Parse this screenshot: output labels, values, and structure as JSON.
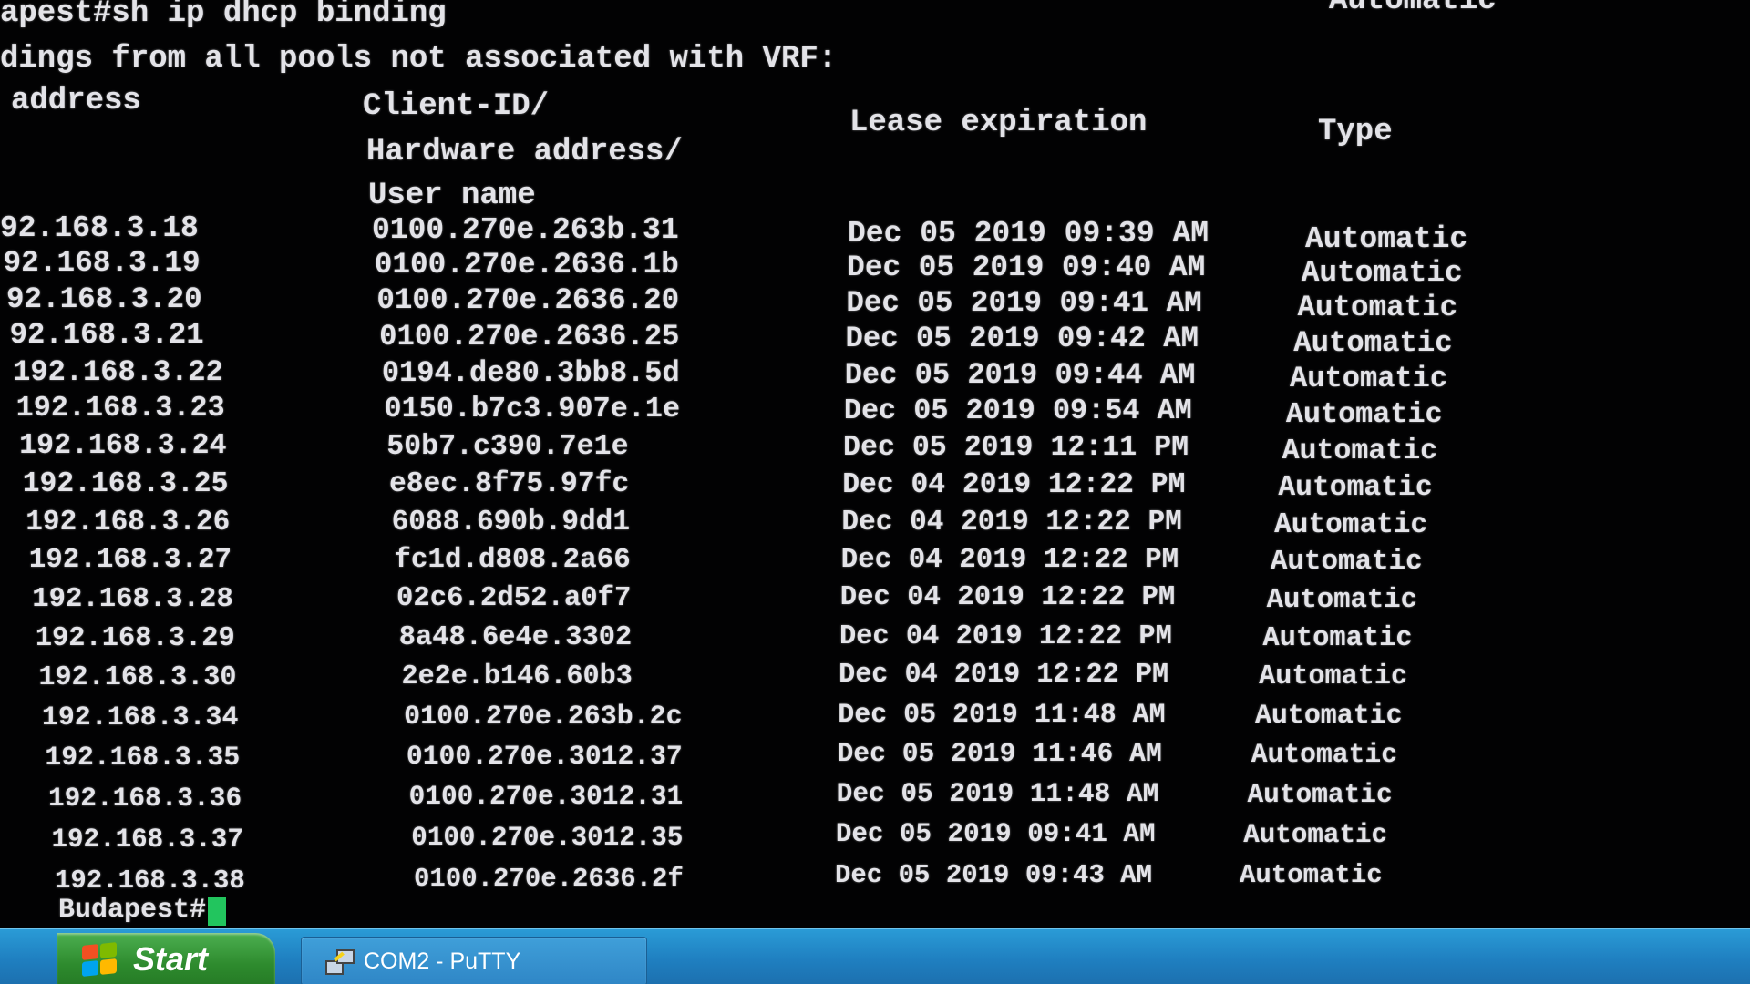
{
  "terminal": {
    "command_line": "apest#sh ip dhcp binding",
    "top_right_fragment": "Automatic",
    "header_line": "dings from all pools not associated with VRF:",
    "columns": {
      "address": "address",
      "client_id_1": "Client-ID/",
      "client_id_2": "Hardware address/",
      "client_id_3": "User name",
      "lease": "Lease expiration",
      "type": "Type"
    },
    "rows": [
      {
        "ip": "92.168.3.18",
        "client": "0100.270e.263b.31",
        "lease": "Dec 05 2019 09:39 AM",
        "type": "Automatic"
      },
      {
        "ip": "92.168.3.19",
        "client": "0100.270e.2636.1b",
        "lease": "Dec 05 2019 09:40 AM",
        "type": "Automatic"
      },
      {
        "ip": "92.168.3.20",
        "client": "0100.270e.2636.20",
        "lease": "Dec 05 2019 09:41 AM",
        "type": "Automatic"
      },
      {
        "ip": "92.168.3.21",
        "client": "0100.270e.2636.25",
        "lease": "Dec 05 2019 09:42 AM",
        "type": "Automatic"
      },
      {
        "ip": "192.168.3.22",
        "client": "0194.de80.3bb8.5d",
        "lease": "Dec 05 2019 09:44 AM",
        "type": "Automatic"
      },
      {
        "ip": "192.168.3.23",
        "client": "0150.b7c3.907e.1e",
        "lease": "Dec 05 2019 09:54 AM",
        "type": "Automatic"
      },
      {
        "ip": "192.168.3.24",
        "client": "50b7.c390.7e1e",
        "lease": "Dec 05 2019 12:11 PM",
        "type": "Automatic"
      },
      {
        "ip": "192.168.3.25",
        "client": "e8ec.8f75.97fc",
        "lease": "Dec 04 2019 12:22 PM",
        "type": "Automatic"
      },
      {
        "ip": "192.168.3.26",
        "client": "6088.690b.9dd1",
        "lease": "Dec 04 2019 12:22 PM",
        "type": "Automatic"
      },
      {
        "ip": "192.168.3.27",
        "client": "fc1d.d808.2a66",
        "lease": "Dec 04 2019 12:22 PM",
        "type": "Automatic"
      },
      {
        "ip": "192.168.3.28",
        "client": "02c6.2d52.a0f7",
        "lease": "Dec 04 2019 12:22 PM",
        "type": "Automatic"
      },
      {
        "ip": "192.168.3.29",
        "client": "8a48.6e4e.3302",
        "lease": "Dec 04 2019 12:22 PM",
        "type": "Automatic"
      },
      {
        "ip": "192.168.3.30",
        "client": "2e2e.b146.60b3",
        "lease": "Dec 04 2019 12:22 PM",
        "type": "Automatic"
      },
      {
        "ip": "192.168.3.34",
        "client": "0100.270e.263b.2c",
        "lease": "Dec 05 2019 11:48 AM",
        "type": "Automatic"
      },
      {
        "ip": "192.168.3.35",
        "client": "0100.270e.3012.37",
        "lease": "Dec 05 2019 11:46 AM",
        "type": "Automatic"
      },
      {
        "ip": "192.168.3.36",
        "client": "0100.270e.3012.31",
        "lease": "Dec 05 2019 11:48 AM",
        "type": "Automatic"
      },
      {
        "ip": "192.168.3.37",
        "client": "0100.270e.3012.35",
        "lease": "Dec 05 2019 09:41 AM",
        "type": "Automatic"
      },
      {
        "ip": "192.168.3.38",
        "client": "0100.270e.2636.2f",
        "lease": "Dec 05 2019 09:43 AM",
        "type": "Automatic"
      }
    ],
    "prompt": "Budapest#"
  },
  "taskbar": {
    "start_label": "Start",
    "task_putty_label": "COM2 - PuTTY"
  },
  "colors": {
    "terminal_bg": "#020203",
    "terminal_fg": "#e3e3e8",
    "cursor": "#22c55e",
    "taskbar": "#1f7fc0",
    "start_button": "#2e8b2e"
  }
}
